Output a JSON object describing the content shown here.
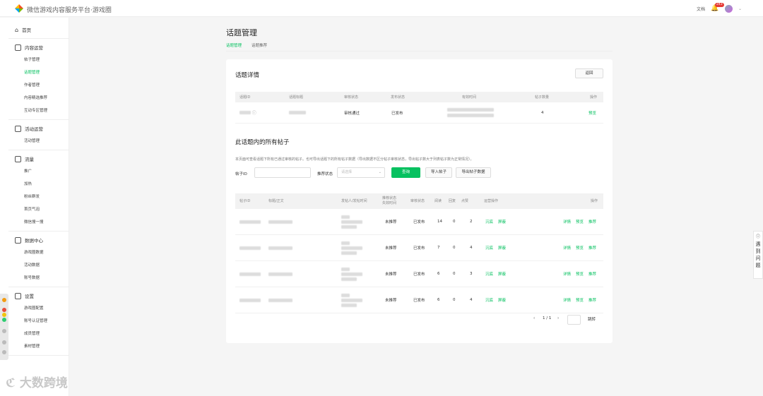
{
  "app": {
    "title": "微信游戏内容服务平台·游戏圈"
  },
  "topbar": {
    "doc": "文档",
    "badge": "243"
  },
  "sidebar": {
    "home": "首页",
    "sections": [
      {
        "label": "内容运营",
        "icon": "doc-icon",
        "items": [
          "帖子管理",
          "话题管理",
          "作者管理",
          "内容精选推荐",
          "互动专区管理"
        ],
        "active": 1
      },
      {
        "label": "活动运营",
        "icon": "grid-icon",
        "items": [
          "活动管理"
        ],
        "active": -1
      },
      {
        "label": "流量",
        "icon": "megaphone-icon",
        "items": [
          "推广",
          "加热",
          "粉丝群发",
          "首页气泡",
          "微信搜一搜"
        ],
        "active": -1
      },
      {
        "label": "数据中心",
        "icon": "chart-icon",
        "items": [
          "游戏圈数据",
          "活动数据",
          "账号数据"
        ],
        "active": -1
      },
      {
        "label": "设置",
        "icon": "gear-icon",
        "items": [
          "游戏圈配置",
          "账号认证管理",
          "成员管理",
          "素材管理"
        ],
        "active": -1
      }
    ]
  },
  "page": {
    "title": "话题管理",
    "tabs": [
      "话题管理",
      "话题推荐"
    ]
  },
  "detail": {
    "title": "话题详情",
    "back": "返回",
    "columns": [
      "话题ID",
      "话题标题",
      "审核状态",
      "发布状态",
      "有效时间",
      "帖子数量",
      "操作"
    ],
    "row": {
      "status": "审核通过",
      "publish": "已发布",
      "count": "4",
      "action": "预览"
    }
  },
  "posts": {
    "title": "此话题内的所有帖子",
    "desc": "本页面可查看话题下所有已通过审核的帖子。也可导出话题下的所有帖子数据（导出数据不区分帖子审核状态，导出帖子数大于列表帖子数为正常情况）。",
    "filter": {
      "id_label": "帖子ID",
      "rec_label": "推荐状态",
      "rec_placeholder": "请选择",
      "query": "查询",
      "import": "导入帖子",
      "export": "导出帖子数据"
    },
    "columns": [
      "帖子ID",
      "标题/正文",
      "发帖人/发帖时间",
      "推荐状态\n失效时间",
      "审核状态",
      "阅读",
      "回复",
      "点赞",
      "运营操作",
      "操作"
    ],
    "rows": [
      {
        "rec": "未推荐",
        "audit": "已发布",
        "read": "14",
        "reply": "0",
        "like": "2",
        "ops": [
          "沉底",
          "屏蔽"
        ],
        "acts": [
          "详情",
          "预览",
          "推荐"
        ]
      },
      {
        "rec": "未推荐",
        "audit": "已发布",
        "read": "7",
        "reply": "0",
        "like": "4",
        "ops": [
          "沉底",
          "屏蔽"
        ],
        "acts": [
          "详情",
          "预览",
          "推荐"
        ]
      },
      {
        "rec": "未推荐",
        "audit": "已发布",
        "read": "6",
        "reply": "0",
        "like": "3",
        "ops": [
          "沉底",
          "屏蔽"
        ],
        "acts": [
          "详情",
          "预览",
          "推荐"
        ]
      },
      {
        "rec": "未推荐",
        "audit": "已发布",
        "read": "6",
        "reply": "0",
        "like": "4",
        "ops": [
          "沉底",
          "屏蔽"
        ],
        "acts": [
          "详情",
          "预览",
          "推荐"
        ]
      }
    ],
    "pager": {
      "page": "1 / 1",
      "jump": "跳转"
    }
  },
  "float": {
    "text": "遇到问题"
  },
  "watermark": "大数跨境",
  "colors": {
    "accent": "#07c160"
  }
}
